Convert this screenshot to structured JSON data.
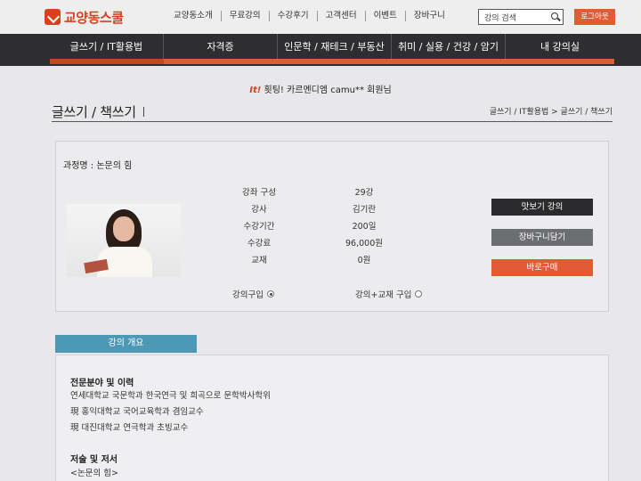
{
  "header": {
    "logo_text": "교양동스쿨",
    "topnav": [
      "교양동소개",
      "무료강의",
      "수강후기",
      "고객센터",
      "이벤트",
      "장바구니"
    ],
    "search_placeholder": "강의 검색",
    "logout_label": "로그아웃"
  },
  "mainnav": {
    "items": [
      "글쓰기 / IT활용법",
      "자격증",
      "인문학 / 재테크 / 부동산",
      "취미 / 실용 / 건강 / 암기",
      "내 강의실"
    ]
  },
  "welcome": {
    "prefix": "It!",
    "message": "횟팅! 카르멘디엠 camu** 회원님"
  },
  "page": {
    "title": "글쓰기 / 책쓰기",
    "breadcrumb": "글쓰기 / IT활용법 > 글쓰기 / 책쓰기"
  },
  "course": {
    "name": "과정명 : 논문의 힘",
    "info": [
      {
        "label": "강좌 구성",
        "value": "29강"
      },
      {
        "label": "강사",
        "value": "김기란"
      },
      {
        "label": "수강기간",
        "value": "200일"
      },
      {
        "label": "수강료",
        "value": "96,000원"
      },
      {
        "label": "교재",
        "value": "0원"
      }
    ],
    "option_lecture": "강의구입",
    "option_lecture_book": "강의+교재 구입",
    "btn_preview": "맛보기 강의",
    "btn_cart": "장바구니담기",
    "btn_buy": "바로구매"
  },
  "overview": {
    "tab_label": "강의 개요",
    "section1_title": "전문분야 및 이력",
    "section1_lines": [
      "연세대학교 국문학과 한국연극 및 희곡으로 문학박사학위",
      "現 홍익대학교 국어교육학과 겸임교수",
      "現 대진대학교 연극학과 초빙교수"
    ],
    "section2_title": "저술 및 저서",
    "section2_lines": [
      "<논문의 힘>"
    ]
  }
}
